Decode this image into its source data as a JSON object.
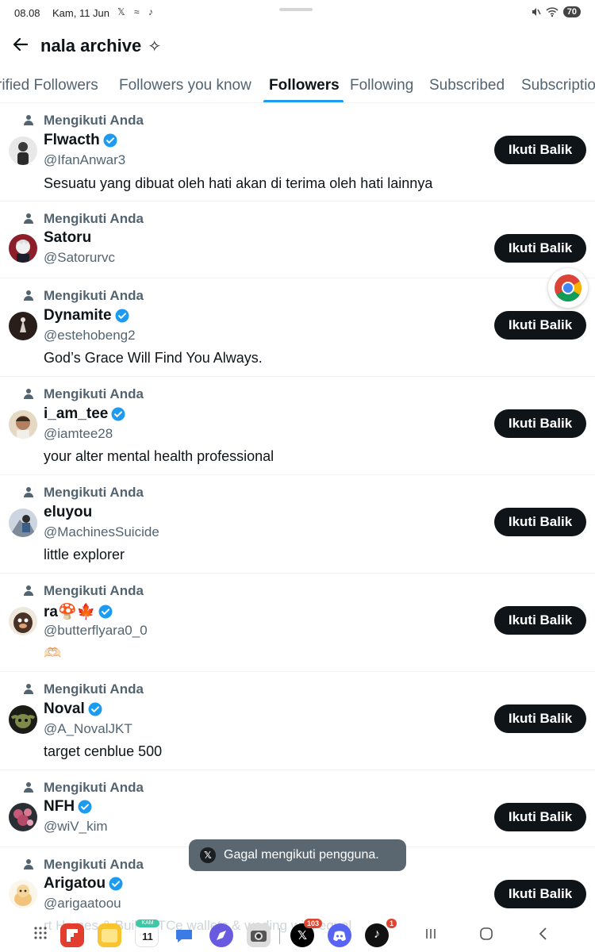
{
  "status_bar": {
    "time": "08.08",
    "date": "Kam, 11 Jun",
    "notification_icons": "𝕏 ≈ ♪",
    "battery": "70"
  },
  "header": {
    "title": "nala archive",
    "title_glyph": "✧"
  },
  "tabs": [
    {
      "label": "rified Followers"
    },
    {
      "label": "Followers you know"
    },
    {
      "label": "Followers"
    },
    {
      "label": "Following"
    },
    {
      "label": "Subscribed"
    },
    {
      "label": "Subscriptio"
    }
  ],
  "follows_you_label": "Mengikuti Anda",
  "follow_back_label": "Ikuti Balik",
  "users": [
    {
      "name": "Flwacth",
      "verified": true,
      "handle": "@IfanAnwar3",
      "bio": "Sesuatu yang dibuat oleh hati akan di terima oleh hati lainnya"
    },
    {
      "name": "Satoru",
      "verified": false,
      "handle": "@Satorurvc",
      "bio": ""
    },
    {
      "name": "Dynamite",
      "verified": true,
      "handle": "@estehobeng2",
      "bio": "God’s Grace Will Find You Always."
    },
    {
      "name": "i_am_tee",
      "verified": true,
      "handle": "@iamtee28",
      "bio": "your alter mental health professional"
    },
    {
      "name": "eluyou",
      "verified": false,
      "handle": "@MachinesSuicide",
      "bio": "little explorer"
    },
    {
      "name": "ra🍄🍁",
      "verified": true,
      "handle": "@butterflyara0_0",
      "bio": "🫶🏻"
    },
    {
      "name": "Noval",
      "verified": true,
      "handle": "@A_NovalJKT",
      "bio": "target cenblue 500"
    },
    {
      "name": "NFH",
      "verified": true,
      "handle": "@wiV_kim",
      "bio": ""
    },
    {
      "name": "Arigatou",
      "verified": true,
      "handle": "@arigaatoou",
      "bio": ""
    }
  ],
  "toast": {
    "message": "Gagal mengikuti pengguna."
  },
  "taskbar": {
    "calendar_day_label": "KAM",
    "calendar_day": "11",
    "x_badge": "103",
    "tiktok_badge": "1",
    "behind_text": "rt Homes & Build BTCe wallets & wading with equal"
  },
  "colors": {
    "accent": "#1d9bf0",
    "primary_text": "#0f1419",
    "secondary_text": "#536471",
    "button_bg": "#0f1419"
  }
}
